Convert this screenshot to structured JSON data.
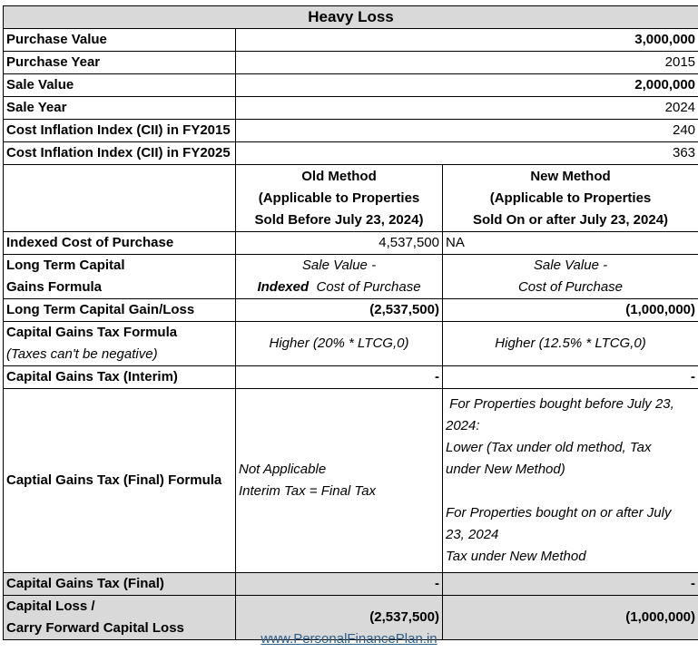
{
  "title": "Heavy Loss",
  "rows": {
    "purchase_value": {
      "label": "Purchase Value",
      "value": "3,000,000"
    },
    "purchase_year": {
      "label": "Purchase Year",
      "value": "2015"
    },
    "sale_value": {
      "label": "Sale Value",
      "value": "2,000,000"
    },
    "sale_year": {
      "label": "Sale Year",
      "value": "2024"
    },
    "cii_2015": {
      "label": "Cost Inflation Index (CII) in FY2015",
      "value": "240"
    },
    "cii_2025": {
      "label": "Cost Inflation Index (CII) in FY2025",
      "value": "363"
    }
  },
  "methods": {
    "old": {
      "line1": "Old Method",
      "line2": "(Applicable to Properties",
      "line3": "Sold Before July 23, 2024)"
    },
    "new": {
      "line1": "New Method",
      "line2": "(Applicable to Properties",
      "line3": "Sold On or after July 23, 2024)"
    }
  },
  "indexed_cost": {
    "label": "Indexed Cost of Purchase",
    "old": "4,537,500",
    "new": "NA"
  },
  "ltcg_formula": {
    "label1": "Long Term Capital",
    "label2": "Gains Formula",
    "old_line1": "Sale Value -",
    "old_line2_bold": "Indexed",
    "old_line2_rest": "Cost of Purchase",
    "new_line1": "Sale Value -",
    "new_line2": "Cost of Purchase"
  },
  "ltcg": {
    "label": "Long Term Capital Gain/Loss",
    "old": "(2,537,500)",
    "new": "(1,000,000)"
  },
  "tax_formula": {
    "label": "Capital Gains Tax Formula",
    "note": "(Taxes can't be negative)",
    "old": "Higher (20% * LTCG,0)",
    "new": "Higher (12.5% * LTCG,0)"
  },
  "tax_interim": {
    "label": "Capital Gains Tax (Interim)",
    "old": "-",
    "new": "-"
  },
  "final_formula": {
    "label": "Captial Gains Tax (Final) Formula",
    "old_line1": "Not Applicable",
    "old_line2": "Interim Tax = Final Tax",
    "new_line1": " For Properties bought before July 23,",
    "new_line2": "2024:",
    "new_line3": "Lower (Tax under old method, Tax",
    "new_line4": "under New Method)",
    "new_line5": "For Properties bought on or after July",
    "new_line6": "23, 2024",
    "new_line7": "Tax under New Method"
  },
  "tax_final": {
    "label": "Capital Gains Tax (Final)",
    "old": "-",
    "new": "-"
  },
  "capital_loss": {
    "label1": "Capital Loss /",
    "label2": "Carry Forward Capital Loss",
    "old": "(2,537,500)",
    "new": "(1,000,000)"
  },
  "footer": "www.PersonalFinancePlan.in"
}
